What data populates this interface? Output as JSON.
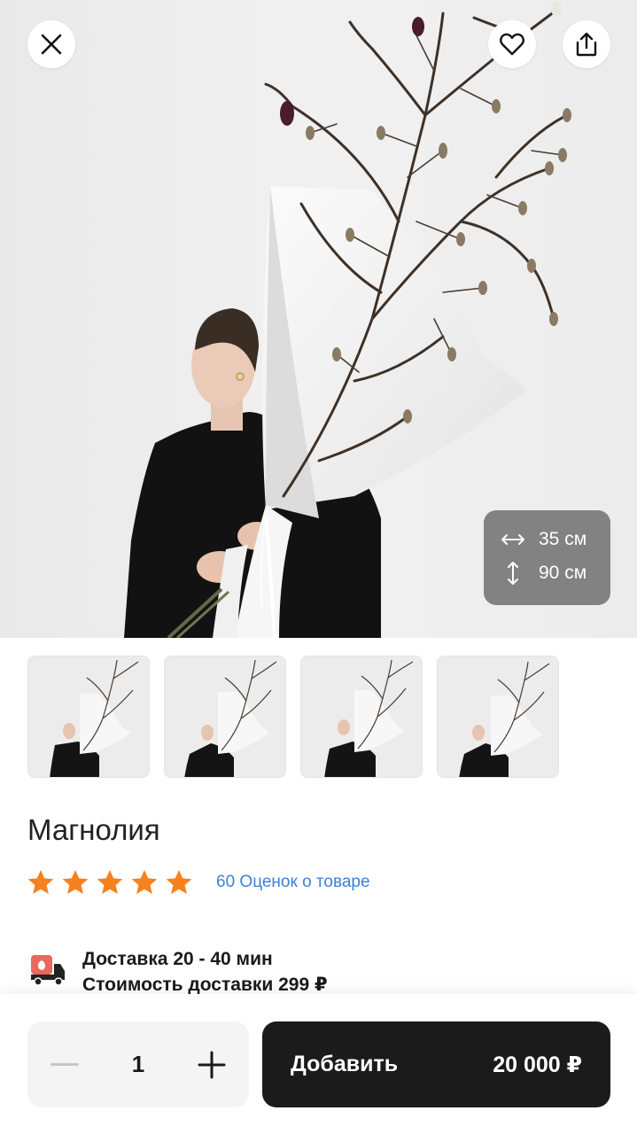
{
  "product": {
    "title": "Магнолия",
    "rating_stars": 5,
    "reviews_label": "60 Оценок о товаре",
    "width_label": "35 см",
    "height_label": "90 см",
    "thumbnail_count": 4
  },
  "delivery": {
    "time_label": "Доставка 20 - 40 мин",
    "cost_label": "Стоимость доставки 299 ₽"
  },
  "cart": {
    "quantity": "1",
    "add_label": "Добавить",
    "price": "20 000 ₽"
  },
  "icons": {
    "close": "close-icon",
    "favorite": "heart-icon",
    "share": "share-icon",
    "width": "horizontal-arrows-icon",
    "height": "vertical-arrows-icon",
    "star": "star-icon",
    "delivery": "delivery-truck-icon",
    "minus": "minus-icon",
    "plus": "plus-icon"
  },
  "colors": {
    "star": "#f5821f",
    "link": "#3b82d6",
    "add_button": "#1b1b1b",
    "delivery_icon": "#e8695e"
  }
}
